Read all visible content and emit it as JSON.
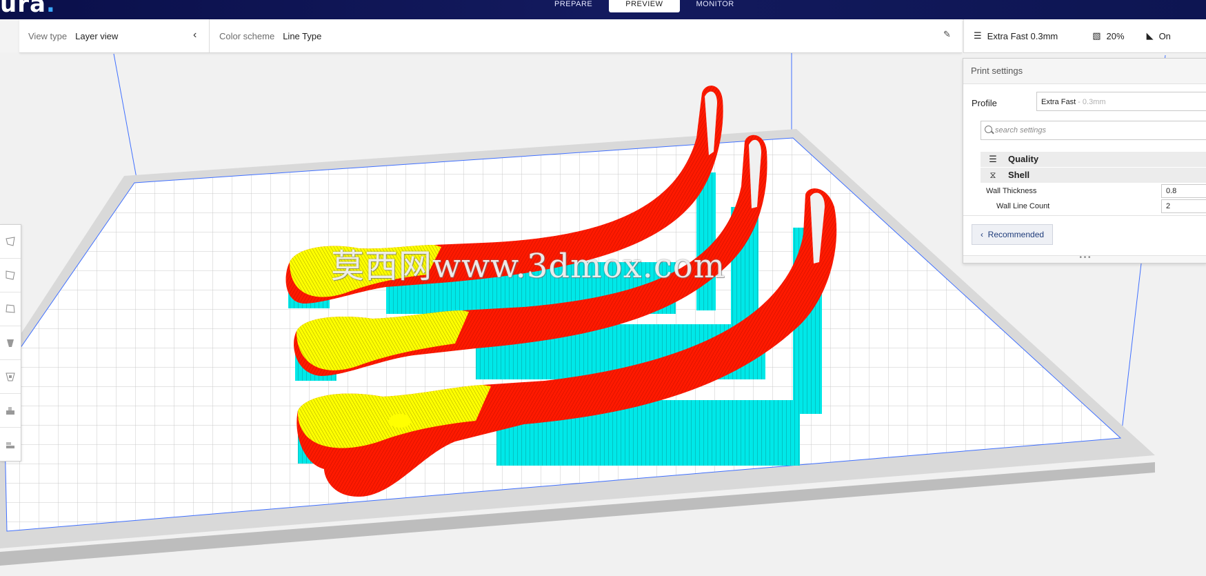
{
  "app": {
    "logo_text": "ura",
    "logo_dot": "."
  },
  "stages": [
    {
      "label": "PREPARE",
      "active": false
    },
    {
      "label": "PREVIEW",
      "active": true
    },
    {
      "label": "MONITOR",
      "active": false
    }
  ],
  "view": {
    "view_type_label": "View type",
    "view_type_value": "Layer view",
    "color_scheme_label": "Color scheme",
    "color_scheme_value": "Line Type"
  },
  "print_summary": {
    "profile": "Extra Fast 0.3mm",
    "infill": "20%",
    "support": "On"
  },
  "print_settings": {
    "title": "Print settings",
    "profile_label": "Profile",
    "profile_name": "Extra Fast",
    "profile_layer": " - 0.3mm",
    "search_placeholder": "search settings",
    "categories": [
      {
        "label": "Quality",
        "icon": "quality-icon"
      },
      {
        "label": "Shell",
        "icon": "shell-icon"
      }
    ],
    "settings": [
      {
        "label": "Wall Thickness",
        "value": "0.8"
      },
      {
        "label": "Wall Line Count",
        "value": "2"
      }
    ],
    "recommended_label": "Recommended",
    "drag_handle": "• • •"
  },
  "watermark": "莫西网www.3dmox.com",
  "colors": {
    "topbar": "#0d1552",
    "wall_inner": "#ffff00",
    "wall_outer": "#ff0000",
    "support": "#00e5e5",
    "build_edge": "#2b6cff"
  },
  "left_tools": [
    "move-tool-icon",
    "scale-tool-icon",
    "rotate-tool-icon",
    "mirror-tool-icon",
    "per-model-settings-icon",
    "support-blocker-icon",
    "layer-icon"
  ]
}
